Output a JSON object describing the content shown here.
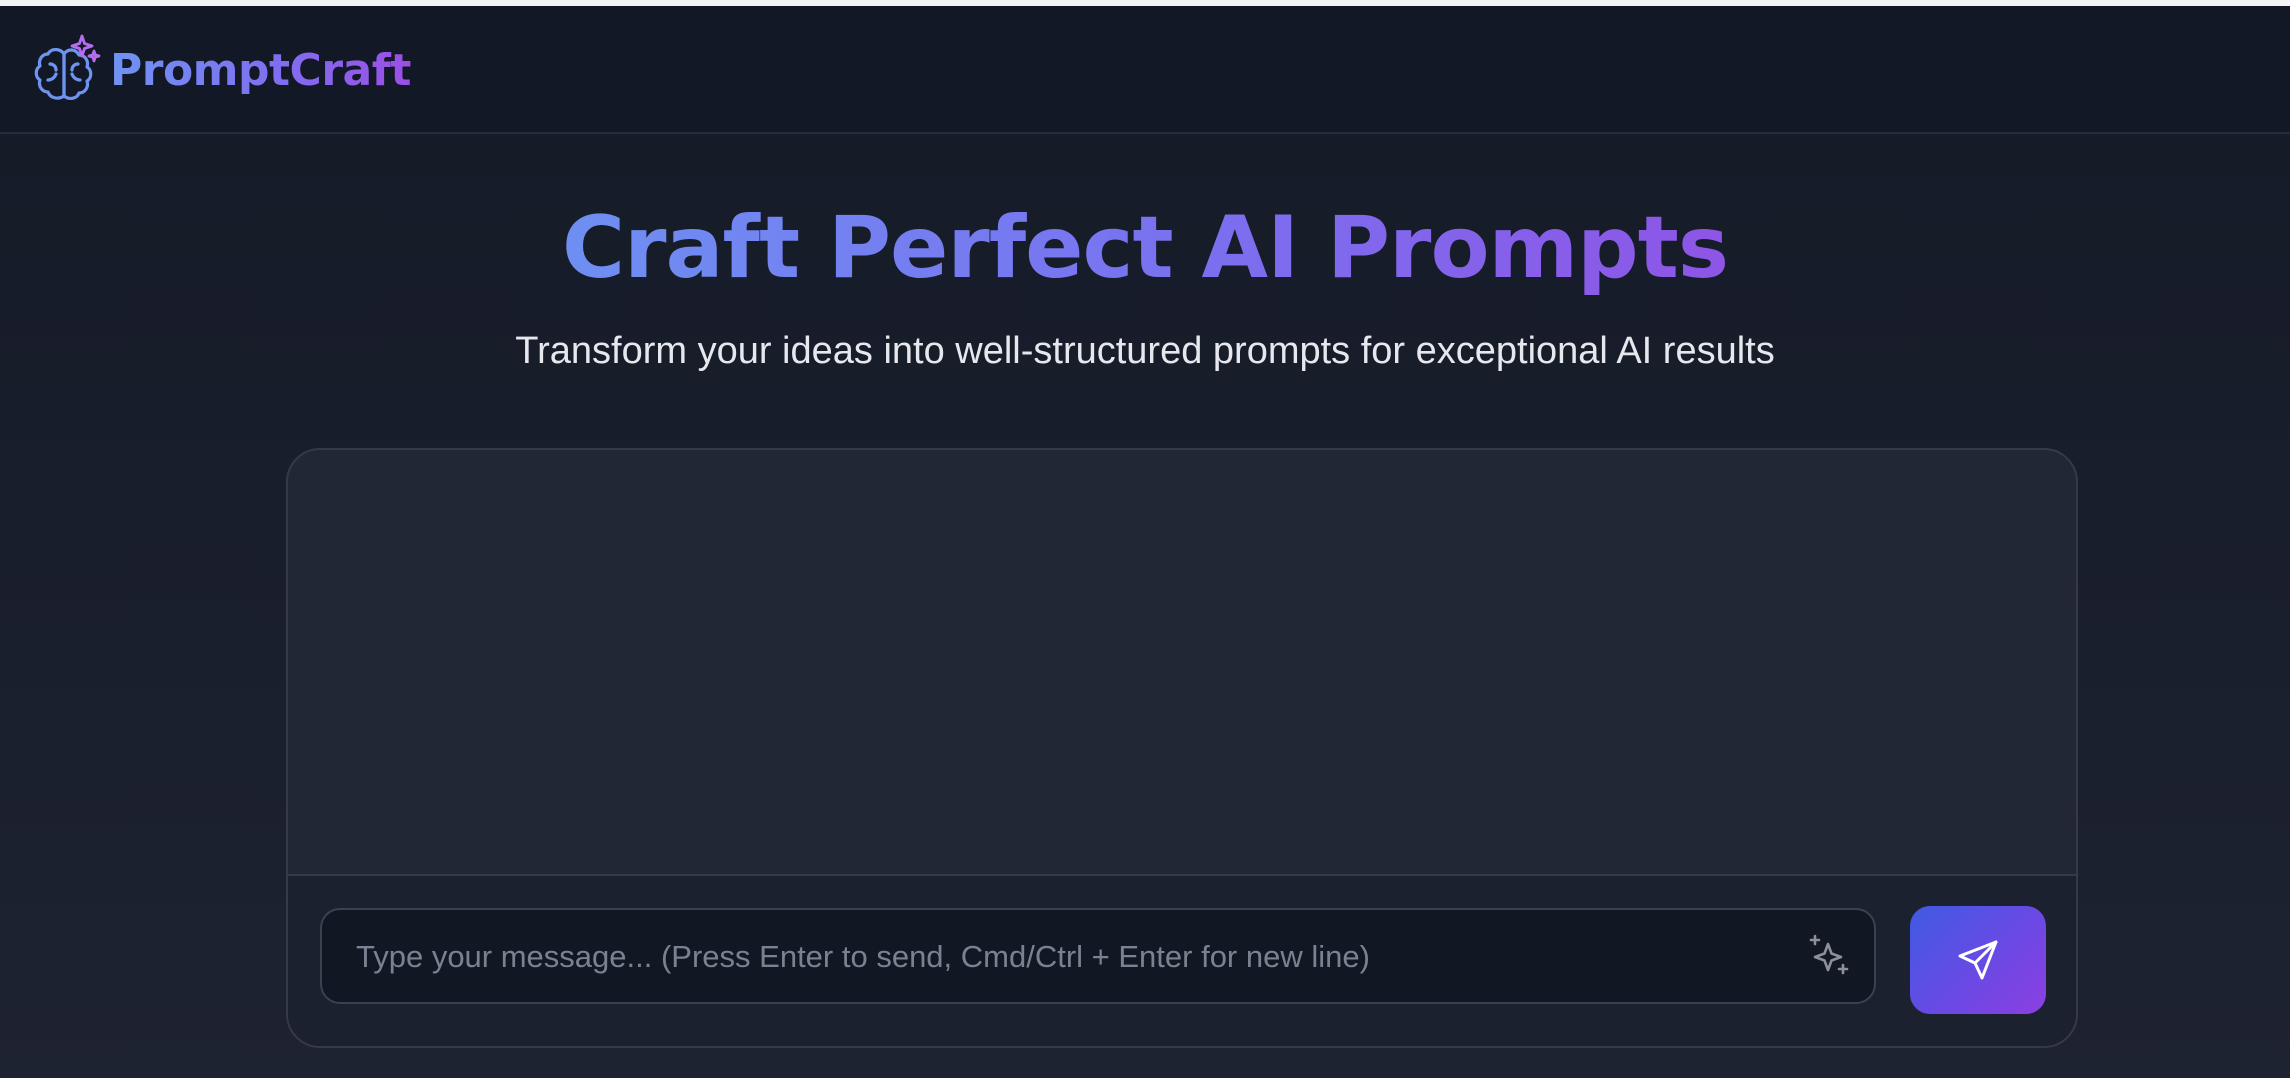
{
  "app": {
    "name": "PromptCraft",
    "logo_icon": "brain-sparkles-icon"
  },
  "hero": {
    "title": "Craft Perfect AI Prompts",
    "subtitle": "Transform your ideas into well-structured prompts for exceptional AI results"
  },
  "chat": {
    "input_placeholder": "Type your message... (Press Enter to send, Cmd/Ctrl + Enter for new line)",
    "input_value": "",
    "enhance_icon": "sparkles-icon",
    "send_icon": "send-icon"
  },
  "colors": {
    "background": "#191e2b",
    "header_bg": "#131826",
    "accent_blue": "#6e8ff2",
    "accent_purple": "#8e55e6",
    "panel_bg": "#222735",
    "input_bg": "#121724"
  }
}
